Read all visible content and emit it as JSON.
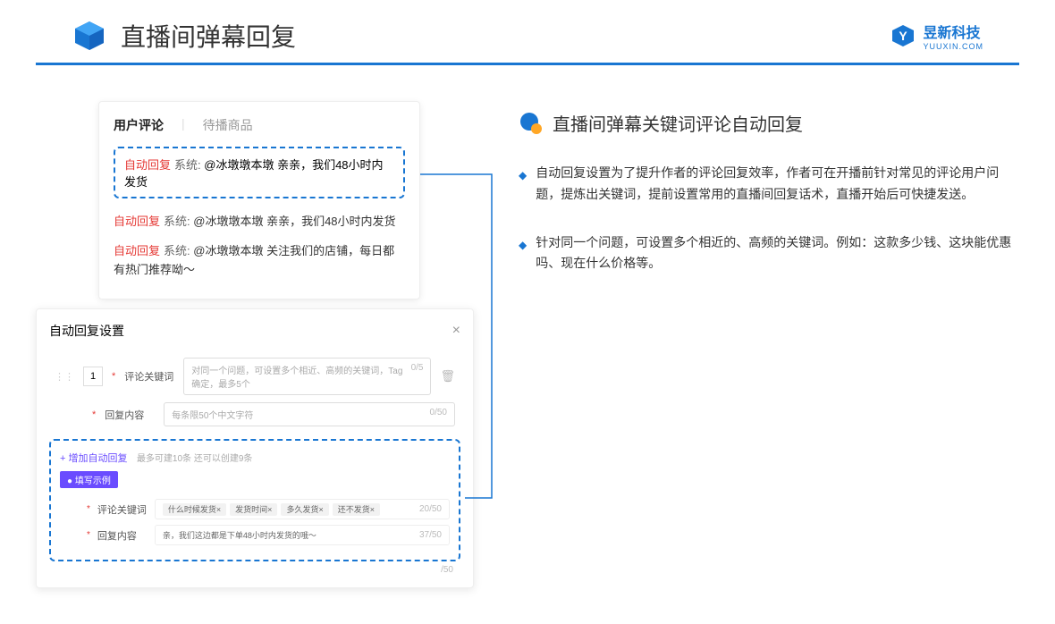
{
  "header": {
    "title": "直播间弹幕回复",
    "logo_text": "昱新科技",
    "logo_sub": "YUUXIN.COM"
  },
  "comments": {
    "tab_active": "用户评论",
    "tab_inactive": "待播商品",
    "highlighted": {
      "tag": "自动回复",
      "sys": "系统:",
      "text": "@冰墩墩本墩 亲亲，我们48小时内发货"
    },
    "row2": {
      "tag": "自动回复",
      "sys": "系统:",
      "text": "@冰墩墩本墩 亲亲，我们48小时内发货"
    },
    "row3": {
      "tag": "自动回复",
      "sys": "系统:",
      "text": "@冰墩墩本墩 关注我们的店铺，每日都有热门推荐呦～"
    }
  },
  "settings": {
    "title": "自动回复设置",
    "num": "1",
    "label1": "评论关键词",
    "placeholder1": "对同一个问题，可设置多个相近、高频的关键词，Tag确定，最多5个",
    "counter1": "0/5",
    "label2": "回复内容",
    "placeholder2": "每条限50个中文字符",
    "counter2": "0/50",
    "add_link": "+ 增加自动回复",
    "add_sub": "最多可建10条 还可以创建9条",
    "example_tag": "● 填写示例",
    "ex_label1": "评论关键词",
    "chip1": "什么时候发货×",
    "chip2": "发货时间×",
    "chip3": "多久发货×",
    "chip4": "还不发货×",
    "ex_counter1": "20/50",
    "ex_label2": "回复内容",
    "ex_text2": "亲，我们这边都是下单48小时内发货的哦～",
    "ex_counter2": "37/50",
    "outer_counter": "/50"
  },
  "right": {
    "section_title": "直播间弹幕关键词评论自动回复",
    "bullet1": "自动回复设置为了提升作者的评论回复效率，作者可在开播前针对常见的评论用户问题，提炼出关键词，提前设置常用的直播间回复话术，直播开始后可快捷发送。",
    "bullet2": "针对同一个问题，可设置多个相近的、高频的关键词。例如：这款多少钱、这块能优惠吗、现在什么价格等。"
  }
}
